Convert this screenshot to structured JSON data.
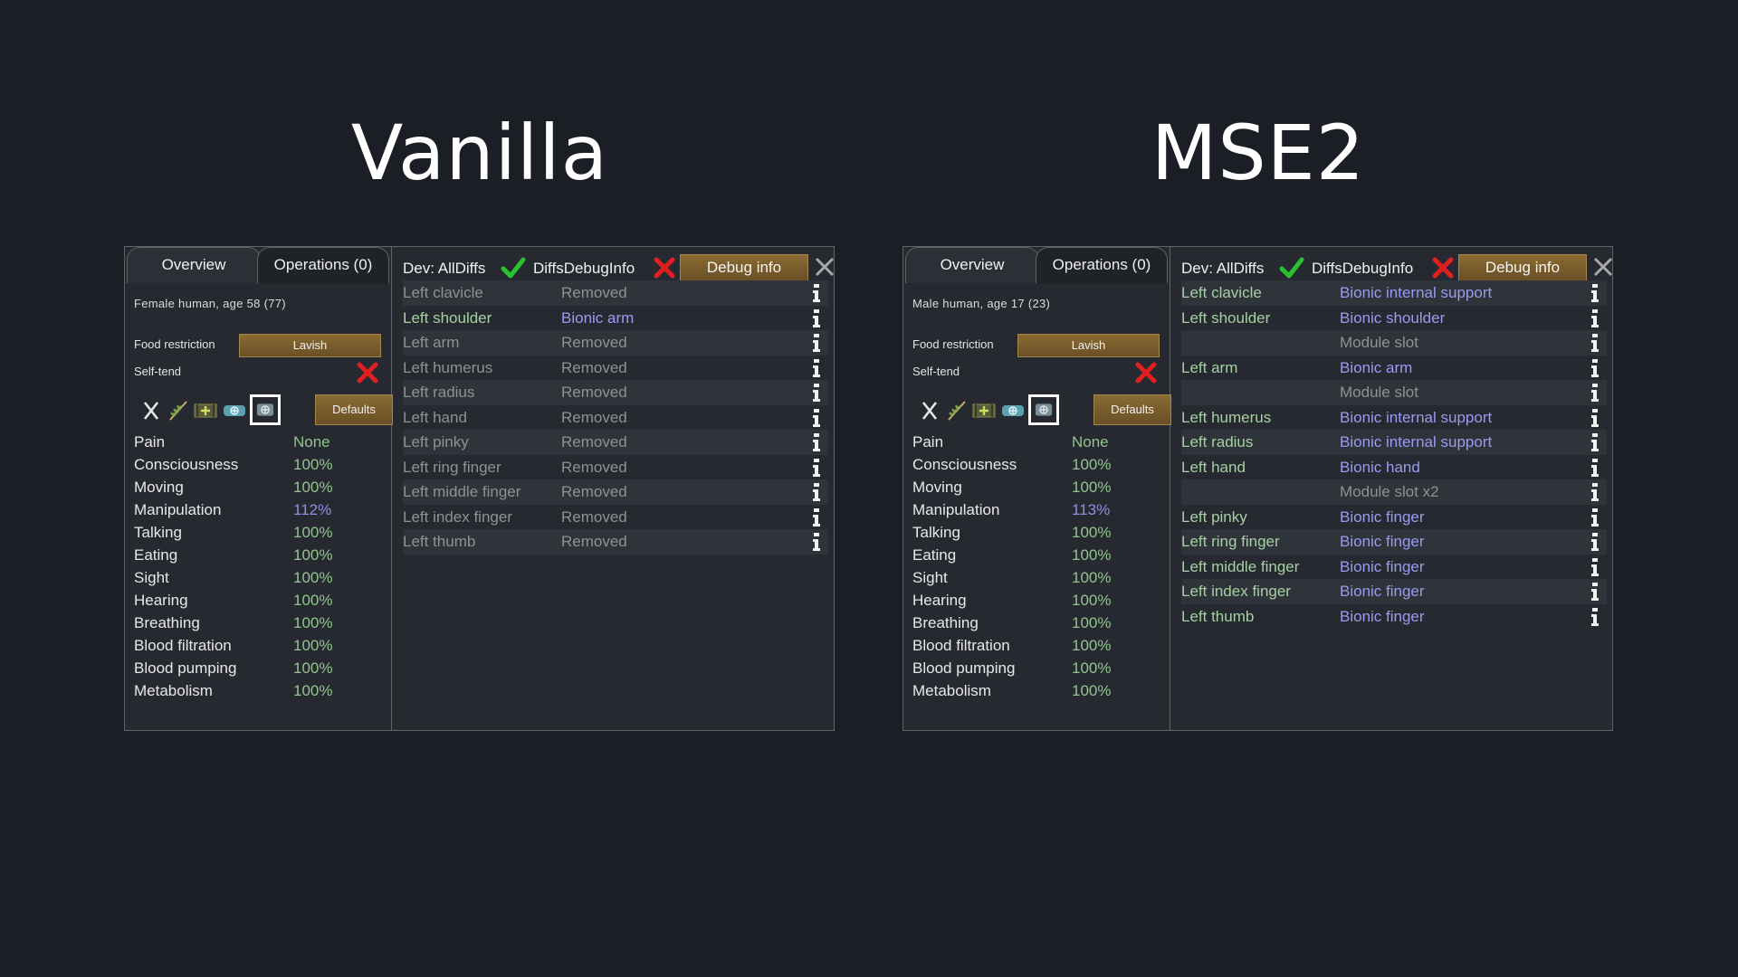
{
  "titles": {
    "left": "Vanilla",
    "right": "MSE2"
  },
  "panels": [
    {
      "tabs": {
        "overview": "Overview",
        "operations": "Operations (0)"
      },
      "pawn_info": "Female human, age 58 (77)",
      "food_restriction_label": "Food restriction",
      "food_restriction_value": "Lavish",
      "self_tend_label": "Self-tend",
      "defaults_label": "Defaults",
      "capacities": [
        {
          "name": "Pain",
          "value": "None"
        },
        {
          "name": "Consciousness",
          "value": "100%"
        },
        {
          "name": "Moving",
          "value": "100%"
        },
        {
          "name": "Manipulation",
          "value": "112%"
        },
        {
          "name": "Talking",
          "value": "100%"
        },
        {
          "name": "Eating",
          "value": "100%"
        },
        {
          "name": "Sight",
          "value": "100%"
        },
        {
          "name": "Hearing",
          "value": "100%"
        },
        {
          "name": "Breathing",
          "value": "100%"
        },
        {
          "name": "Blood filtration",
          "value": "100%"
        },
        {
          "name": "Blood pumping",
          "value": "100%"
        },
        {
          "name": "Metabolism",
          "value": "100%"
        }
      ],
      "dev_alldiffs": "Dev: AllDiffs",
      "dev_diffsdebuginfo": "DiffsDebugInfo",
      "debug_info_label": "Debug info",
      "health_rows": [
        {
          "part": "Left clavicle",
          "condition": "Removed",
          "part_color": "gray",
          "cond_color": "gray"
        },
        {
          "part": "Left shoulder",
          "condition": "Bionic arm",
          "part_color": "green",
          "cond_color": "blue"
        },
        {
          "part": "Left arm",
          "condition": "Removed",
          "part_color": "gray",
          "cond_color": "gray"
        },
        {
          "part": "Left humerus",
          "condition": "Removed",
          "part_color": "gray",
          "cond_color": "gray"
        },
        {
          "part": "Left radius",
          "condition": "Removed",
          "part_color": "gray",
          "cond_color": "gray"
        },
        {
          "part": "Left hand",
          "condition": "Removed",
          "part_color": "gray",
          "cond_color": "gray"
        },
        {
          "part": "Left pinky",
          "condition": "Removed",
          "part_color": "gray",
          "cond_color": "gray"
        },
        {
          "part": "Left ring finger",
          "condition": "Removed",
          "part_color": "gray",
          "cond_color": "gray"
        },
        {
          "part": "Left middle finger",
          "condition": "Removed",
          "part_color": "gray",
          "cond_color": "gray"
        },
        {
          "part": "Left index finger",
          "condition": "Removed",
          "part_color": "gray",
          "cond_color": "gray"
        },
        {
          "part": "Left thumb",
          "condition": "Removed",
          "part_color": "gray",
          "cond_color": "gray"
        }
      ]
    },
    {
      "tabs": {
        "overview": "Overview",
        "operations": "Operations (0)"
      },
      "pawn_info": "Male human, age 17 (23)",
      "food_restriction_label": "Food restriction",
      "food_restriction_value": "Lavish",
      "self_tend_label": "Self-tend",
      "defaults_label": "Defaults",
      "capacities": [
        {
          "name": "Pain",
          "value": "None"
        },
        {
          "name": "Consciousness",
          "value": "100%"
        },
        {
          "name": "Moving",
          "value": "100%"
        },
        {
          "name": "Manipulation",
          "value": "113%"
        },
        {
          "name": "Talking",
          "value": "100%"
        },
        {
          "name": "Eating",
          "value": "100%"
        },
        {
          "name": "Sight",
          "value": "100%"
        },
        {
          "name": "Hearing",
          "value": "100%"
        },
        {
          "name": "Breathing",
          "value": "100%"
        },
        {
          "name": "Blood filtration",
          "value": "100%"
        },
        {
          "name": "Blood pumping",
          "value": "100%"
        },
        {
          "name": "Metabolism",
          "value": "100%"
        }
      ],
      "dev_alldiffs": "Dev: AllDiffs",
      "dev_diffsdebuginfo": "DiffsDebugInfo",
      "debug_info_label": "Debug info",
      "health_rows": [
        {
          "part": "Left clavicle",
          "condition": "Bionic internal support",
          "part_color": "green",
          "cond_color": "blue"
        },
        {
          "part": "Left shoulder",
          "condition": "Bionic shoulder",
          "part_color": "green",
          "cond_color": "blue"
        },
        {
          "part": "",
          "condition": "Module slot",
          "part_color": "green",
          "cond_color": "gray"
        },
        {
          "part": "Left arm",
          "condition": "Bionic arm",
          "part_color": "green",
          "cond_color": "blue"
        },
        {
          "part": "",
          "condition": "Module slot",
          "part_color": "green",
          "cond_color": "gray"
        },
        {
          "part": "Left humerus",
          "condition": "Bionic internal support",
          "part_color": "green",
          "cond_color": "blue"
        },
        {
          "part": "Left radius",
          "condition": "Bionic internal support",
          "part_color": "green",
          "cond_color": "blue"
        },
        {
          "part": "Left hand",
          "condition": "Bionic hand",
          "part_color": "green",
          "cond_color": "blue"
        },
        {
          "part": "",
          "condition": "Module slot x2",
          "part_color": "green",
          "cond_color": "gray"
        },
        {
          "part": "Left pinky",
          "condition": "Bionic finger",
          "part_color": "green",
          "cond_color": "blue"
        },
        {
          "part": "Left ring finger",
          "condition": "Bionic finger",
          "part_color": "green",
          "cond_color": "blue"
        },
        {
          "part": "Left middle finger",
          "condition": "Bionic finger",
          "part_color": "green",
          "cond_color": "blue"
        },
        {
          "part": "Left index finger",
          "condition": "Bionic finger",
          "part_color": "green",
          "cond_color": "blue"
        },
        {
          "part": "Left thumb",
          "condition": "Bionic finger",
          "part_color": "green",
          "cond_color": "blue"
        }
      ]
    }
  ],
  "icons": {
    "check": "check-icon",
    "cross": "red-x-icon",
    "close": "close-icon",
    "info": "info-icon",
    "care": [
      "no-care-icon",
      "herbal-medicine-icon",
      "industrial-medicine-icon",
      "glitterworld-medicine-icon",
      "best-medicine-icon"
    ]
  },
  "colors": {
    "positive": "#92c48f",
    "boosted": "#8f8fe4",
    "removed": "#8f9194",
    "bionic": "#9a9af0",
    "button": "#7a5c2c"
  }
}
